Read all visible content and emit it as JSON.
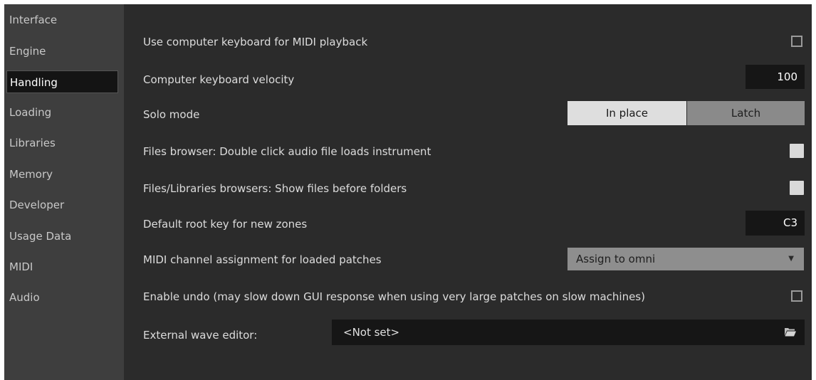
{
  "sidebar": {
    "items": [
      {
        "label": "Interface",
        "active": false
      },
      {
        "label": "Engine",
        "active": false
      },
      {
        "label": "Handling",
        "active": true
      },
      {
        "label": "Loading",
        "active": false
      },
      {
        "label": "Libraries",
        "active": false
      },
      {
        "label": "Memory",
        "active": false
      },
      {
        "label": "Developer",
        "active": false
      },
      {
        "label": "Usage Data",
        "active": false
      },
      {
        "label": "MIDI",
        "active": false
      },
      {
        "label": "Audio",
        "active": false
      }
    ]
  },
  "settings": {
    "midi_playback": {
      "label": "Use computer keyboard for MIDI playback",
      "checked": false
    },
    "velocity": {
      "label": "Computer keyboard velocity",
      "value": "100"
    },
    "solo_mode": {
      "label": "Solo mode",
      "options": [
        "In place",
        "Latch"
      ],
      "selected": "In place"
    },
    "double_click": {
      "label": "Files browser: Double click audio file loads instrument",
      "checked": true
    },
    "files_first": {
      "label": "Files/Libraries browsers: Show files before folders",
      "checked": true
    },
    "root_key": {
      "label": "Default root key for new zones",
      "value": "C3"
    },
    "midi_channel": {
      "label": "MIDI channel assignment for loaded patches",
      "value": "Assign to omni"
    },
    "undo": {
      "label": "Enable undo (may slow down GUI response when using very large patches on slow machines)",
      "checked": false
    },
    "wave_editor": {
      "label": "External wave editor:",
      "value": "<Not set>"
    }
  },
  "colors": {
    "window_bg": "#2b2b2b",
    "sidebar_bg": "#3e3e3e",
    "active_nav_bg": "#141414",
    "field_bg": "#161616",
    "segment_on": "#dedede",
    "segment_off": "#8a8a8a"
  },
  "icons": {
    "dropdown_arrow": "chevron-down-icon",
    "browse": "folder-icon"
  }
}
